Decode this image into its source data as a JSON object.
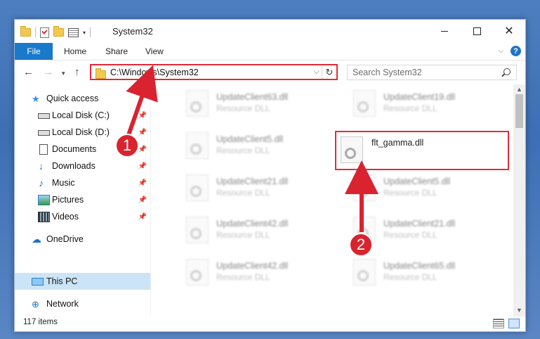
{
  "window": {
    "title": "System32"
  },
  "ribbon": {
    "tabs": [
      "File",
      "Home",
      "Share",
      "View"
    ]
  },
  "nav": {
    "address": "C:\\Windows\\System32",
    "search_placeholder": "Search System32"
  },
  "sidebar": {
    "items": [
      {
        "label": "Quick access",
        "icon": "star-icon"
      },
      {
        "label": "Local Disk (C:)",
        "icon": "drive-icon",
        "pinned": true
      },
      {
        "label": "Local Disk (D:)",
        "icon": "drive-icon",
        "pinned": true
      },
      {
        "label": "Documents",
        "icon": "documents-icon",
        "pinned": true
      },
      {
        "label": "Downloads",
        "icon": "download-icon",
        "pinned": true
      },
      {
        "label": "Music",
        "icon": "music-icon",
        "pinned": true
      },
      {
        "label": "Pictures",
        "icon": "pictures-icon",
        "pinned": true
      },
      {
        "label": "Videos",
        "icon": "videos-icon",
        "pinned": true
      },
      {
        "label": "OneDrive",
        "icon": "cloud-icon"
      },
      {
        "label": "This PC",
        "icon": "pc-icon",
        "selected": true
      },
      {
        "label": "Network",
        "icon": "network-icon"
      }
    ]
  },
  "files": {
    "left": [
      {
        "name": "UpdateClient63.dll",
        "type": "Resource DLL"
      },
      {
        "name": "UpdateClient5.dll",
        "type": "Resource DLL"
      },
      {
        "name": "UpdateClient21.dll",
        "type": "Resource DLL"
      },
      {
        "name": "UpdateClient42.dll",
        "type": "Resource DLL"
      },
      {
        "name": "UpdateClient42.dll",
        "type": "Resource DLL"
      }
    ],
    "right": [
      {
        "name": "UpdateClient19.dll",
        "type": "Resource DLL"
      },
      {
        "name": "flt_gamma.dll",
        "type": ""
      },
      {
        "name": "UpdateClient5.dll",
        "type": "Resource DLL"
      },
      {
        "name": "UpdateClient21.dll",
        "type": "Resource DLL"
      },
      {
        "name": "UpdateClient65.dll",
        "type": "Resource DLL"
      }
    ]
  },
  "status": {
    "item_count": "117 items"
  },
  "callouts": [
    "1",
    "2"
  ],
  "colors": {
    "highlight": "#e02b3a",
    "callout": "#d9232f",
    "file_tab": "#1979ca",
    "selected": "#cce4f7"
  }
}
